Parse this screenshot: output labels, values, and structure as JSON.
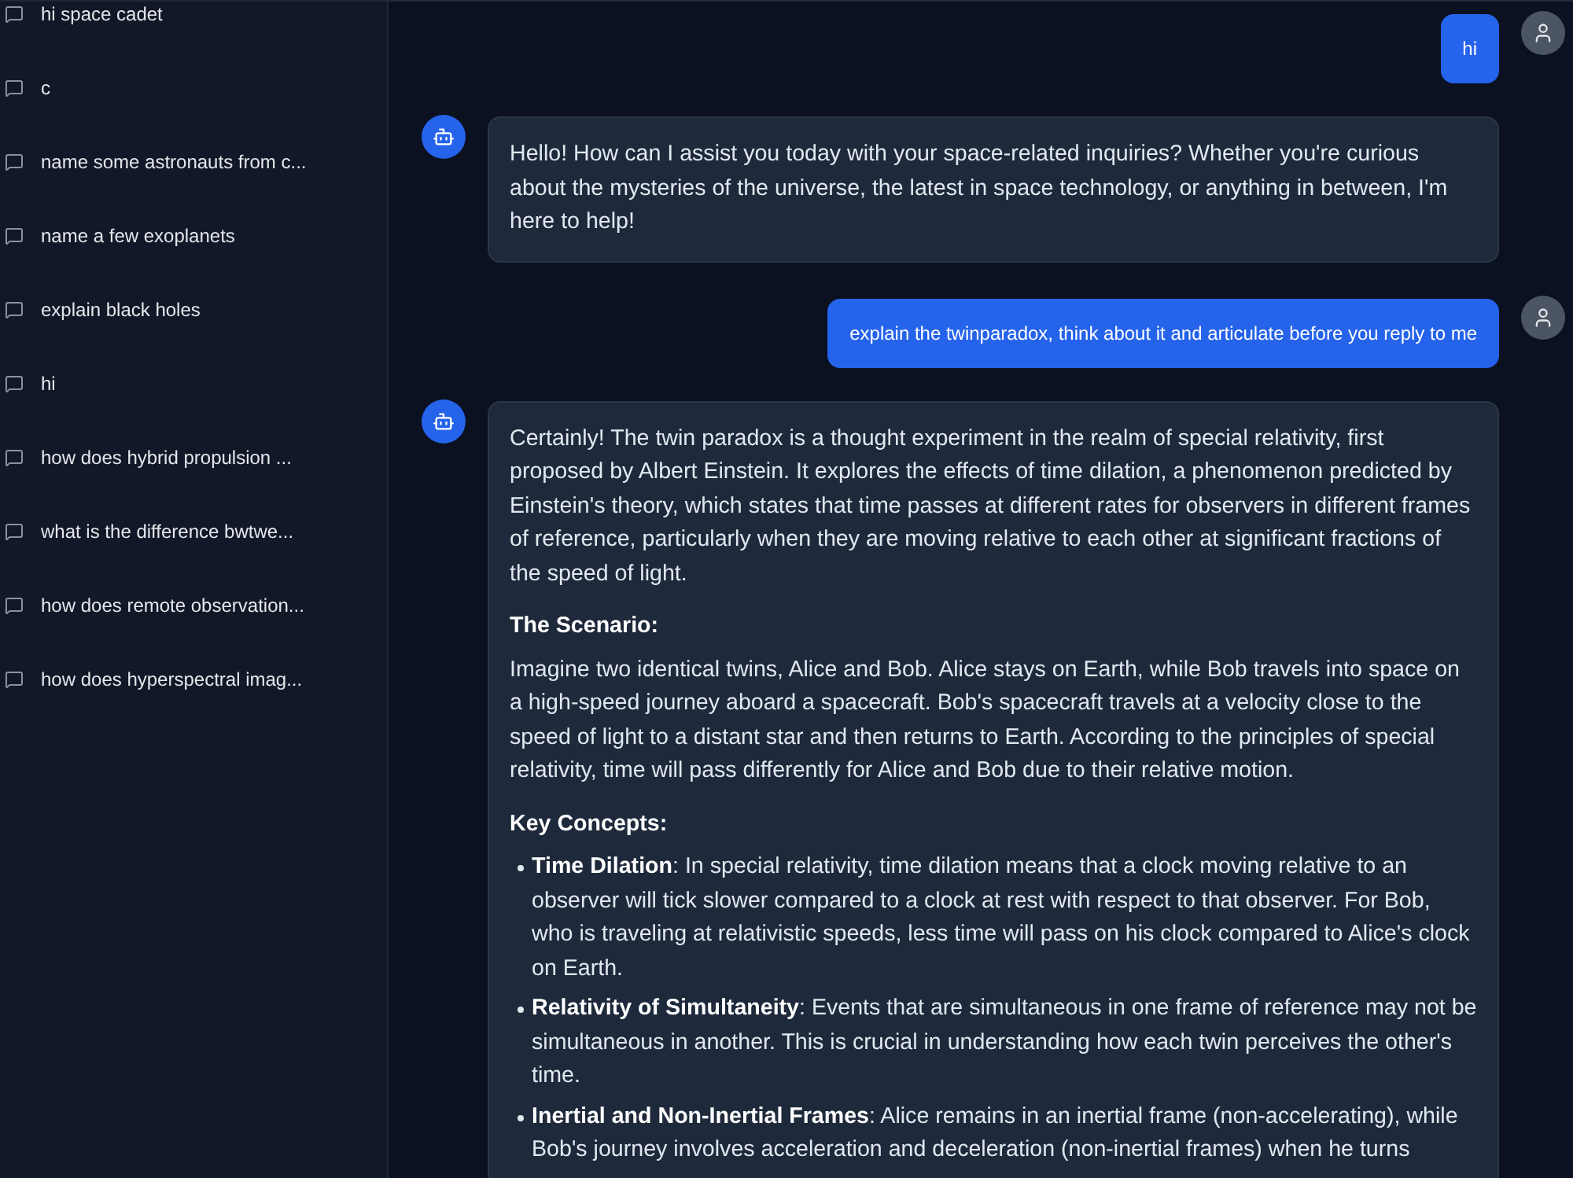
{
  "sidebar": {
    "conversations": [
      {
        "title": "hi space cadet"
      },
      {
        "title": "c"
      },
      {
        "title": "name some astronauts from c..."
      },
      {
        "title": "name a few exoplanets"
      },
      {
        "title": "explain black holes"
      },
      {
        "title": "hi"
      },
      {
        "title": "how does hybrid propulsion ..."
      },
      {
        "title": "what is the difference bwtwe..."
      },
      {
        "title": "how does remote observation..."
      },
      {
        "title": "how does hyperspectral imag..."
      }
    ]
  },
  "messages": [
    {
      "kind": "user",
      "text": "hi"
    },
    {
      "kind": "assistant",
      "blocks": [
        {
          "kind": "paragraph",
          "text": "Hello! How can I assist you today with your space-related inquiries? Whether you're curious about the mysteries of the universe, the latest in space technology, or anything in between, I'm here to help!"
        }
      ]
    },
    {
      "kind": "user",
      "text": "explain the twinparadox, think about it and articulate before you reply to me"
    },
    {
      "kind": "assistant",
      "blocks": [
        {
          "kind": "paragraph",
          "text": "Certainly! The twin paradox is a thought experiment in the realm of special relativity, first proposed by Albert Einstein. It explores the effects of time dilation, a phenomenon predicted by Einstein's theory, which states that time passes at different rates for observers in different frames of reference, particularly when they are moving relative to each other at significant fractions of the speed of light."
        },
        {
          "kind": "heading",
          "text": "The Scenario:"
        },
        {
          "kind": "paragraph",
          "text": "Imagine two identical twins, Alice and Bob. Alice stays on Earth, while Bob travels into space on a high-speed journey aboard a spacecraft. Bob's spacecraft travels at a velocity close to the speed of light to a distant star and then returns to Earth. According to the principles of special relativity, time will pass differently for Alice and Bob due to their relative motion."
        },
        {
          "kind": "heading",
          "text": "Key Concepts:"
        },
        {
          "kind": "list",
          "items": [
            "**Time Dilation**: In special relativity, time dilation means that a clock moving relative to an observer will tick slower compared to a clock at rest with respect to that observer. For Bob, who is traveling at relativistic speeds, less time will pass on his clock compared to Alice's clock on Earth.",
            "**Relativity of Simultaneity**: Events that are simultaneous in one frame of reference may not be simultaneous in another. This is crucial in understanding how each twin perceives the other's time.",
            "**Inertial and Non-Inertial Frames**: Alice remains in an inertial frame (non-accelerating), while Bob's journey involves acceleration and deceleration (non-inertial frames) when he turns"
          ]
        }
      ]
    }
  ]
}
